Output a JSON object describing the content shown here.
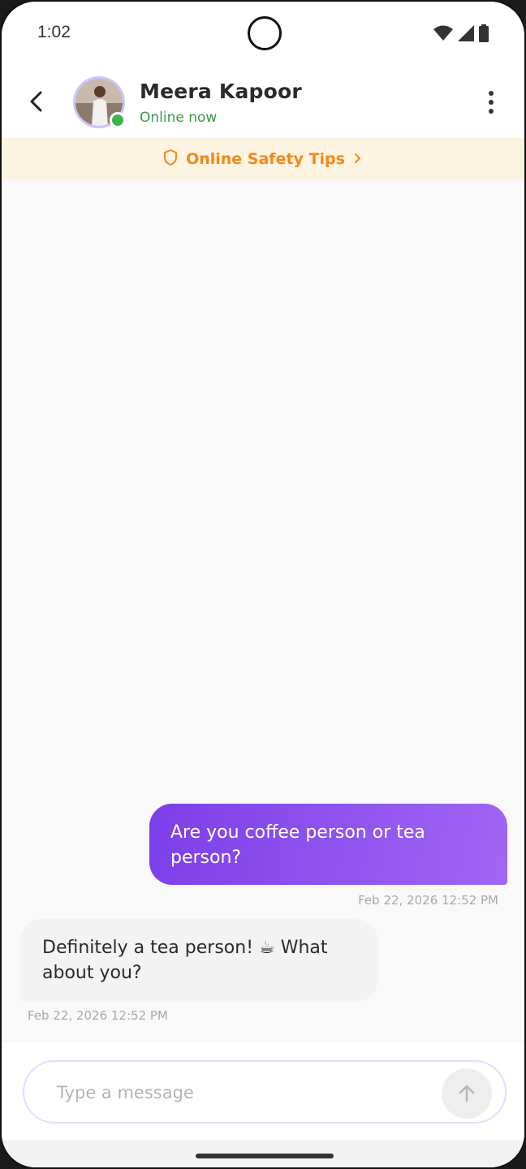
{
  "status_bar": {
    "time": "1:02"
  },
  "header": {
    "contact_name": "Meera Kapoor",
    "contact_status": "Online now"
  },
  "safety_banner": {
    "label": "Online Safety Tips"
  },
  "messages": [
    {
      "direction": "outgoing",
      "text": "Are you coffee person or tea person?",
      "timestamp": "Feb 22, 2026 12:52 PM"
    },
    {
      "direction": "incoming",
      "text": "Definitely a tea person! ☕ What about you?",
      "timestamp": "Feb 22, 2026 12:52 PM"
    }
  ],
  "composer": {
    "placeholder": "Type a message"
  },
  "colors": {
    "accent_start": "#7c3fe8",
    "accent_end": "#a066f5",
    "online": "#3fb34f",
    "safety": "#f08a1e"
  },
  "icons": [
    "back-arrow-icon",
    "more-vert-icon",
    "shield-icon",
    "chevron-right-icon",
    "send-arrow-icon",
    "wifi-icon",
    "signal-icon",
    "battery-icon"
  ]
}
